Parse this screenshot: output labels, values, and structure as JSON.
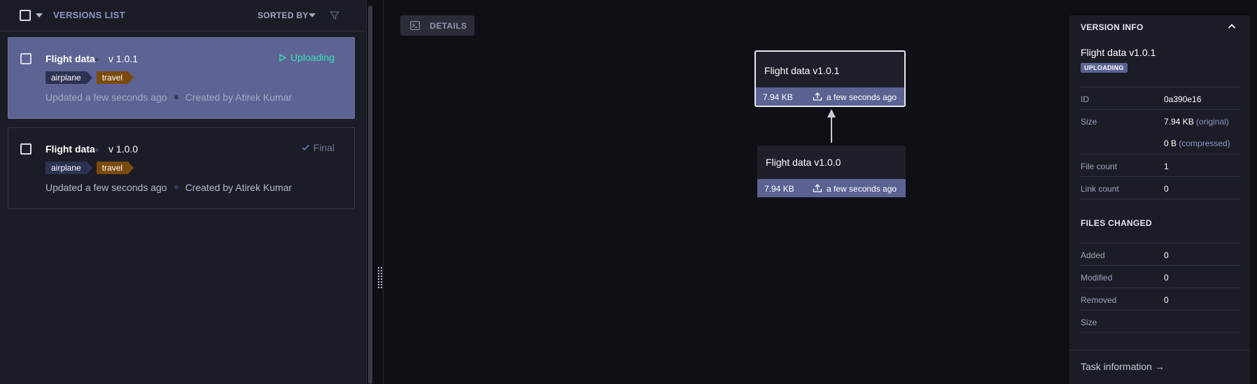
{
  "versions_list": {
    "title": "VERSIONS LIST",
    "sorted_by_label": "SORTED BY",
    "items": [
      {
        "name": "Flight data",
        "version": "v 1.0.1",
        "status": "Uploading",
        "tags": [
          "airplane",
          "travel"
        ],
        "updated": "Updated a few seconds ago",
        "created_by": "Created by Atirek Kumar",
        "selected": true
      },
      {
        "name": "Flight data",
        "version": "v 1.0.0",
        "status": "Final",
        "tags": [
          "airplane",
          "travel"
        ],
        "updated": "Updated a few seconds ago",
        "created_by": "Created by Atirek Kumar",
        "selected": false
      }
    ]
  },
  "graph": {
    "details_button": "DETAILS",
    "nodes": [
      {
        "title": "Flight data v1.0.1",
        "size": "7.94 KB",
        "time": "a few seconds ago",
        "active": true
      },
      {
        "title": "Flight data v1.0.0",
        "size": "7.94 KB",
        "time": "a few seconds ago",
        "active": false
      }
    ]
  },
  "version_info": {
    "section_title": "VERSION INFO",
    "name": "Flight data v1.0.1",
    "badge": "UPLOADING",
    "rows": [
      {
        "key": "ID",
        "value": "0a390e16",
        "note": ""
      },
      {
        "key": "Size",
        "value": "7.94 KB",
        "note": "(original)"
      },
      {
        "key": "",
        "value": "0 B",
        "note": "(compressed)"
      },
      {
        "key": "File count",
        "value": "1",
        "note": ""
      },
      {
        "key": "Link count",
        "value": "0",
        "note": ""
      }
    ],
    "files_changed_title": "FILES CHANGED",
    "files_changed": [
      {
        "key": "Added",
        "value": "0"
      },
      {
        "key": "Modified",
        "value": "0"
      },
      {
        "key": "Removed",
        "value": "0"
      },
      {
        "key": "Size",
        "value": ""
      }
    ],
    "task_link": "Task information →"
  },
  "colors": {
    "accent": "#5b6393",
    "uploading": "#38e0b9",
    "tag_airplane": "#2d3253",
    "tag_travel": "#7b4a0d"
  }
}
